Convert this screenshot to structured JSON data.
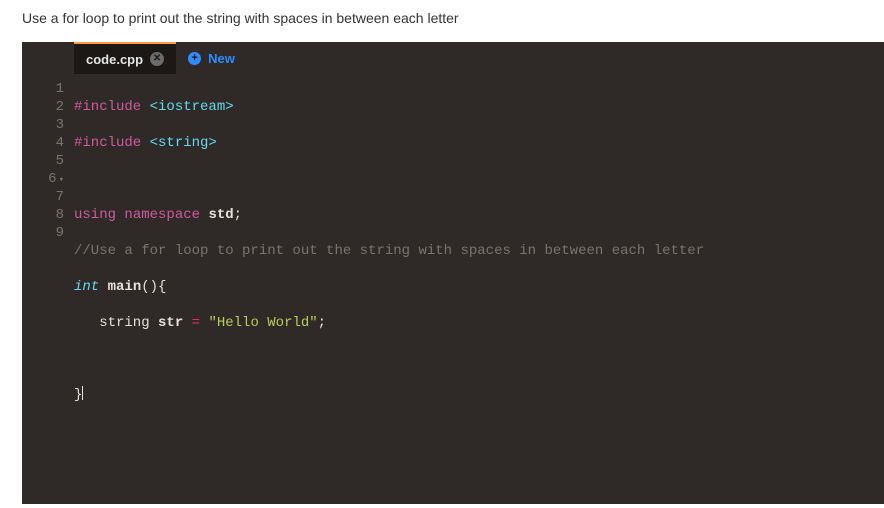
{
  "instruction": "Use a for loop to print out the string with spaces in between each letter",
  "tabs": {
    "active": {
      "label": "code.cpp"
    },
    "new": {
      "label": "New"
    }
  },
  "gutter": {
    "l1": "1",
    "l2": "2",
    "l3": "3",
    "l4": "4",
    "l5": "5",
    "l6": "6",
    "l7": "7",
    "l8": "8",
    "l9": "9"
  },
  "code": {
    "l1a": "#include ",
    "l1b": "<iostream>",
    "l2a": "#include ",
    "l2b": "<string>",
    "l3": "",
    "l4a": "using ",
    "l4b": "namespace ",
    "l4c": "std",
    "l4d": ";",
    "l5": "//Use a for loop to print out the string with spaces in between each letter",
    "l6a": "int ",
    "l6b": "main",
    "l6c": "(){",
    "l7a": "   string ",
    "l7b": "str",
    "l7c": " = ",
    "l7d": "\"Hello World\"",
    "l7e": ";",
    "l8": "",
    "l9": "}"
  }
}
